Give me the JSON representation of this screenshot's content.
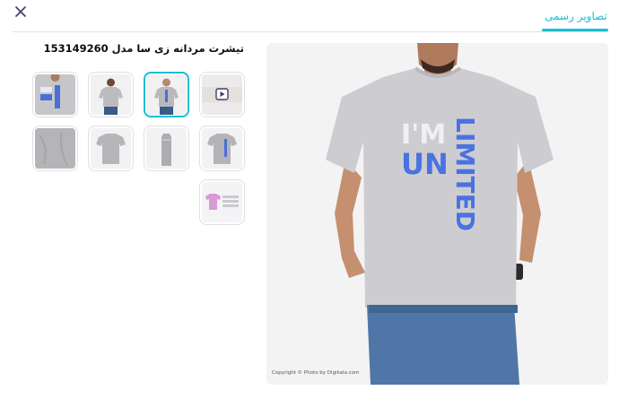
{
  "header": {
    "tab_label": "تصاویر رسمی",
    "accent_color": "#19bfd3",
    "close_icon": "close-icon"
  },
  "product": {
    "title": "تیشرت مردانه زی سا مدل 153149260"
  },
  "thumbnails": [
    {
      "kind": "video",
      "icon": "play-icon"
    },
    {
      "kind": "model-front",
      "selected": true
    },
    {
      "kind": "model-back"
    },
    {
      "kind": "model-front-print"
    },
    {
      "kind": "tshirt-side-print"
    },
    {
      "kind": "tshirt-folded"
    },
    {
      "kind": "tshirt-flat"
    },
    {
      "kind": "fabric-detail"
    },
    {
      "kind": "color-swatch"
    }
  ],
  "main_image": {
    "print_text_1": "I'M",
    "print_text_2": "UN",
    "print_text_3": "LIMITED",
    "copyright": "Copyright © Photo by Digikala.com"
  }
}
